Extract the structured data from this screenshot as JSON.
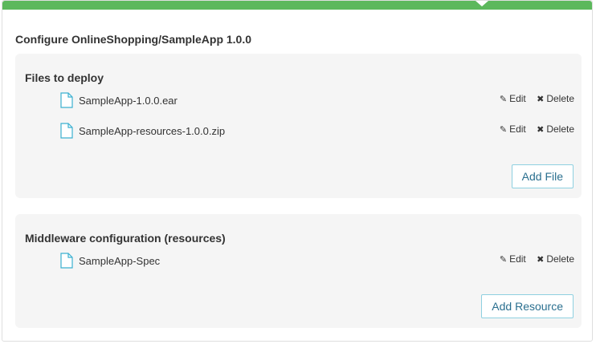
{
  "dialog": {
    "title": "Configure OnlineShopping/SampleApp 1.0.0",
    "accent_color": "#5cb85c"
  },
  "files_section": {
    "heading": "Files to deploy",
    "items": [
      {
        "name": "SampleApp-1.0.0.ear",
        "icon": "file-icon"
      },
      {
        "name": "SampleApp-resources-1.0.0.zip",
        "icon": "file-icon"
      }
    ],
    "add_label": "Add File"
  },
  "middleware_section": {
    "heading": "Middleware configuration (resources)",
    "items": [
      {
        "name": "SampleApp-Spec",
        "icon": "file-icon"
      }
    ],
    "add_label": "Add Resource"
  },
  "actions": {
    "edit_label": "Edit",
    "delete_label": "Delete",
    "edit_icon": "pencil-icon",
    "delete_icon": "close-icon"
  },
  "colors": {
    "button_border": "#8ed0e0",
    "button_text": "#2a6f8f",
    "file_icon": "#3bb0d0",
    "section_bg": "#f5f5f5"
  }
}
